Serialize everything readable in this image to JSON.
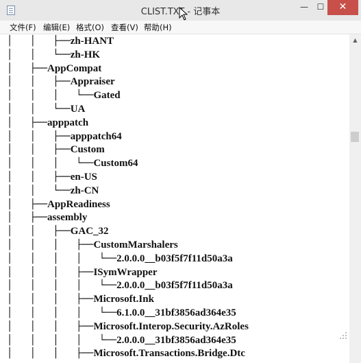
{
  "window": {
    "title": "CLIST.TXT - 记事本",
    "minimize_label": "—",
    "maximize_label": "☐",
    "close_label": "✕"
  },
  "menu": [
    "文件(F)",
    "编辑(E)",
    "格式(O)",
    "查看(V)",
    "帮助(H)"
  ],
  "lines": [
    {
      "prefix": "│   │   ├──",
      "text": "zh-HANT"
    },
    {
      "prefix": "│   │   └──",
      "text": "zh-HK"
    },
    {
      "prefix": "│   ├──",
      "text": "AppCompat"
    },
    {
      "prefix": "│   │   ├──",
      "text": "Appraiser"
    },
    {
      "prefix": "│   │   │   └──",
      "text": "Gated"
    },
    {
      "prefix": "│   │   └──",
      "text": "UA"
    },
    {
      "prefix": "│   ├──",
      "text": "apppatch"
    },
    {
      "prefix": "│   │   ├──",
      "text": "apppatch64"
    },
    {
      "prefix": "│   │   ├──",
      "text": "Custom"
    },
    {
      "prefix": "│   │   │   └──",
      "text": "Custom64"
    },
    {
      "prefix": "│   │   ├──",
      "text": "en-US"
    },
    {
      "prefix": "│   │   └──",
      "text": "zh-CN"
    },
    {
      "prefix": "│   ├──",
      "text": "AppReadiness"
    },
    {
      "prefix": "│   ├──",
      "text": "assembly"
    },
    {
      "prefix": "│   │   ├──",
      "text": "GAC_32"
    },
    {
      "prefix": "│   │   │   ├──",
      "text": "CustomMarshalers"
    },
    {
      "prefix": "│   │   │   │   └──",
      "text": "2.0.0.0__b03f5f7f11d50a3a"
    },
    {
      "prefix": "│   │   │   ├──",
      "text": "ISymWrapper"
    },
    {
      "prefix": "│   │   │   │   └──",
      "text": "2.0.0.0__b03f5f7f11d50a3a"
    },
    {
      "prefix": "│   │   │   ├──",
      "text": "Microsoft.Ink"
    },
    {
      "prefix": "│   │   │   │   └──",
      "text": "6.1.0.0__31bf3856ad364e35"
    },
    {
      "prefix": "│   │   │   ├──",
      "text": "Microsoft.Interop.Security.AzRoles"
    },
    {
      "prefix": "│   │   │   │   └──",
      "text": "2.0.0.0__31bf3856ad364e35"
    },
    {
      "prefix": "│   │   │   ├──",
      "text": "Microsoft.Transactions.Bridge.Dtc"
    }
  ],
  "colors": {
    "close_button": "#c7504a",
    "titlebar": "#e8e8e8",
    "text": "#111111"
  }
}
